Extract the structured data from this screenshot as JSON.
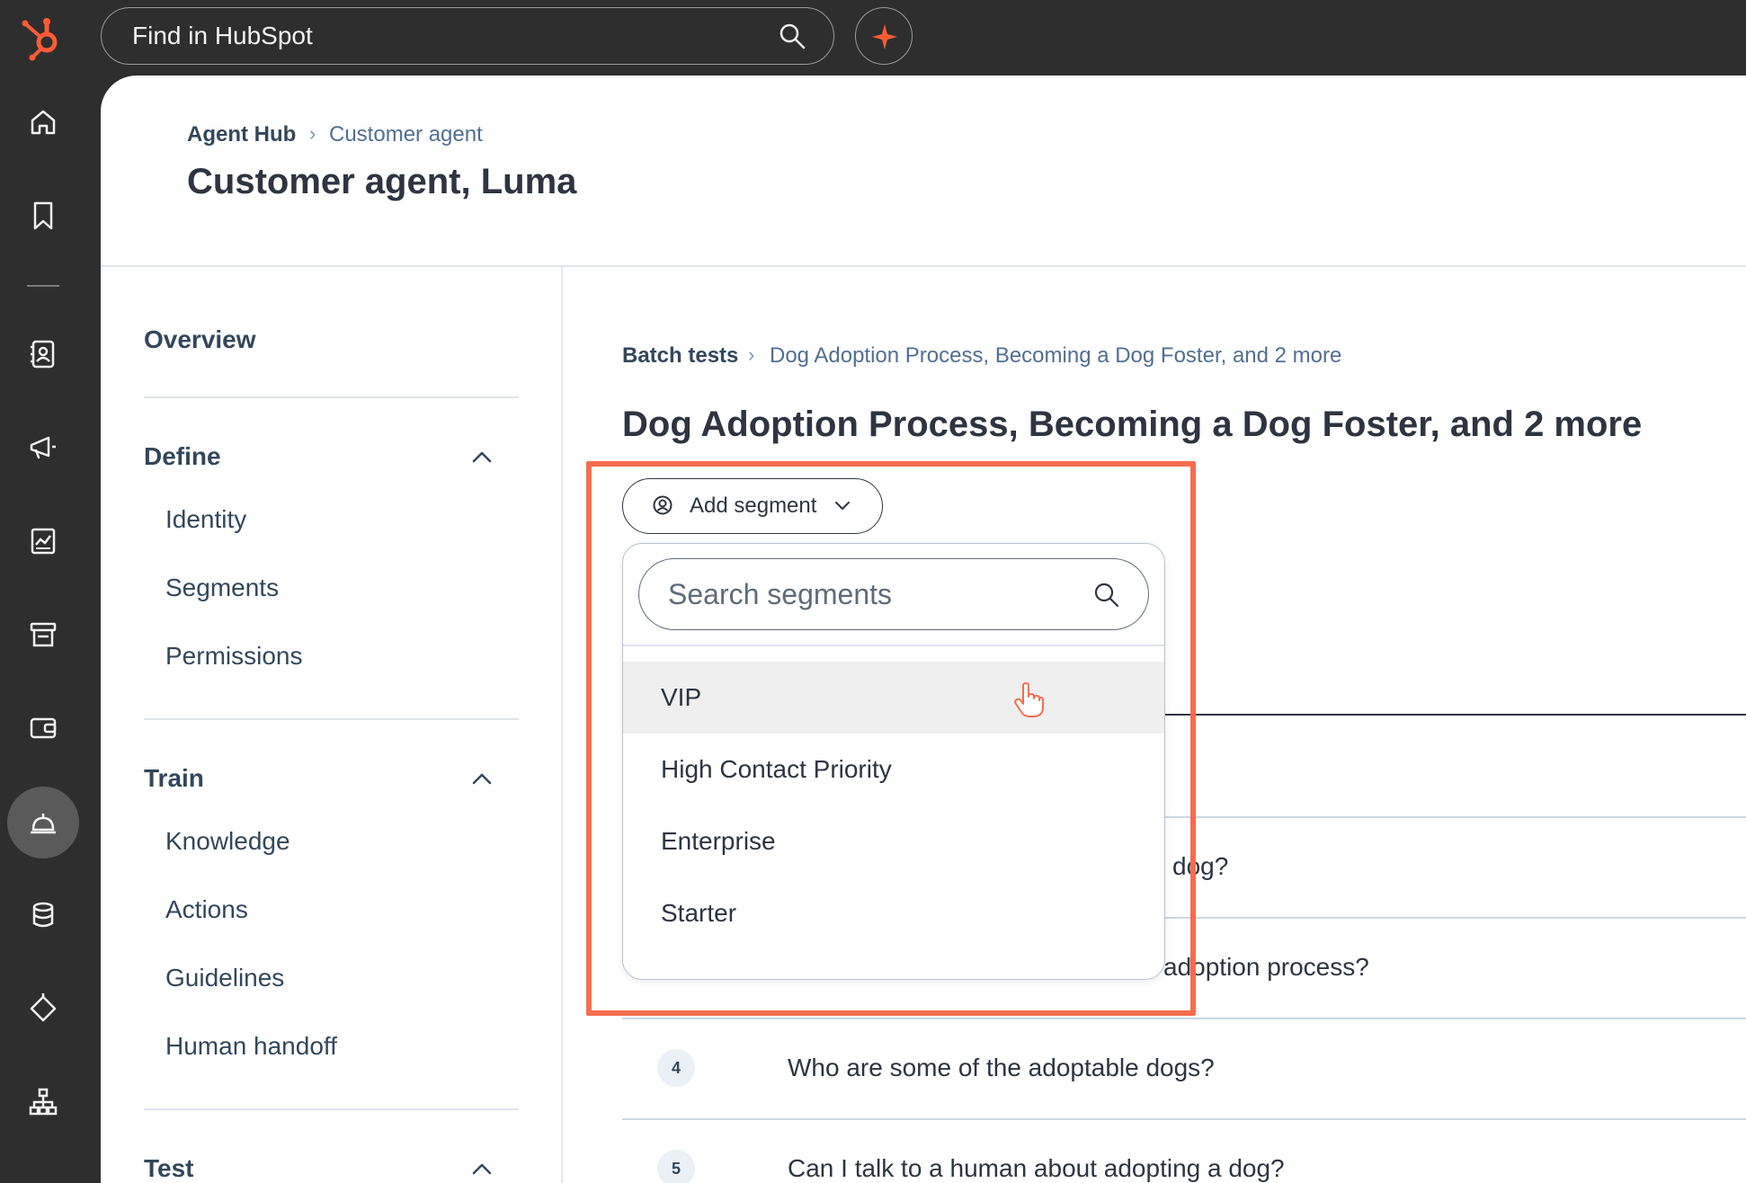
{
  "topbar": {
    "search_placeholder": "Find in HubSpot"
  },
  "colors": {
    "brand_orange": "#ff5c35",
    "highlight": "#f46d4f",
    "topbar_bg": "#2e2e2e"
  },
  "rail": {
    "icons": [
      "home-icon",
      "bookmark-icon",
      "contacts-icon",
      "marketing-icon",
      "reports-icon",
      "commerce-icon",
      "wallet-icon",
      "service-icon",
      "data-icon",
      "automation-icon",
      "org-chart-icon"
    ]
  },
  "header": {
    "breadcrumb_root": "Agent Hub",
    "breadcrumb_current": "Customer agent",
    "title": "Customer agent, Luma"
  },
  "subnav": {
    "overview": "Overview",
    "sections": [
      {
        "label": "Define",
        "items": [
          "Identity",
          "Segments",
          "Permissions"
        ]
      },
      {
        "label": "Train",
        "items": [
          "Knowledge",
          "Actions",
          "Guidelines",
          "Human handoff"
        ]
      },
      {
        "label": "Test",
        "items": []
      }
    ]
  },
  "content": {
    "breadcrumb_root": "Batch tests",
    "breadcrumb_current": "Dog Adoption Process, Becoming a Dog Foster, and 2 more",
    "title": "Dog Adoption Process, Becoming a Dog Foster, and 2 more",
    "add_segment_label": "Add segment",
    "rows": [
      {
        "num": "",
        "text": "dog?"
      },
      {
        "num": "",
        "text": "adoption process?"
      },
      {
        "num": "4",
        "text": "Who are some of the adoptable dogs?"
      },
      {
        "num": "5",
        "text": "Can I talk to a human about adopting a dog?"
      }
    ]
  },
  "dropdown": {
    "search_placeholder": "Search segments",
    "options": [
      "VIP",
      "High Contact Priority",
      "Enterprise",
      "Starter"
    ],
    "hovered_option": "VIP"
  }
}
